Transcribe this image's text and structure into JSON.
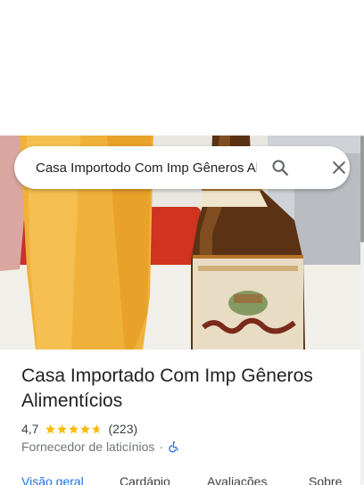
{
  "search": {
    "query": "Casa Importodo Com Imp Gêneros Alimentícios",
    "search_icon": "search-icon",
    "close_icon": "close-icon"
  },
  "place": {
    "title": "Casa Importado Com Imp Gêneros Alimentícios",
    "rating": "4,7",
    "stars": 4.7,
    "review_count": "(223)",
    "category": "Fornecedor de laticínios",
    "separator": "·",
    "accessibility_icon": "wheelchair-icon"
  },
  "tabs": [
    {
      "label": "Visão geral",
      "active": true
    },
    {
      "label": "Cardápio",
      "active": false
    },
    {
      "label": "Avaliações",
      "active": false
    },
    {
      "label": "Sobre",
      "active": false
    }
  ],
  "colors": {
    "accent": "#1a73e8",
    "star": "#fbbc04",
    "text": "#202124",
    "secondary": "#70757a"
  }
}
